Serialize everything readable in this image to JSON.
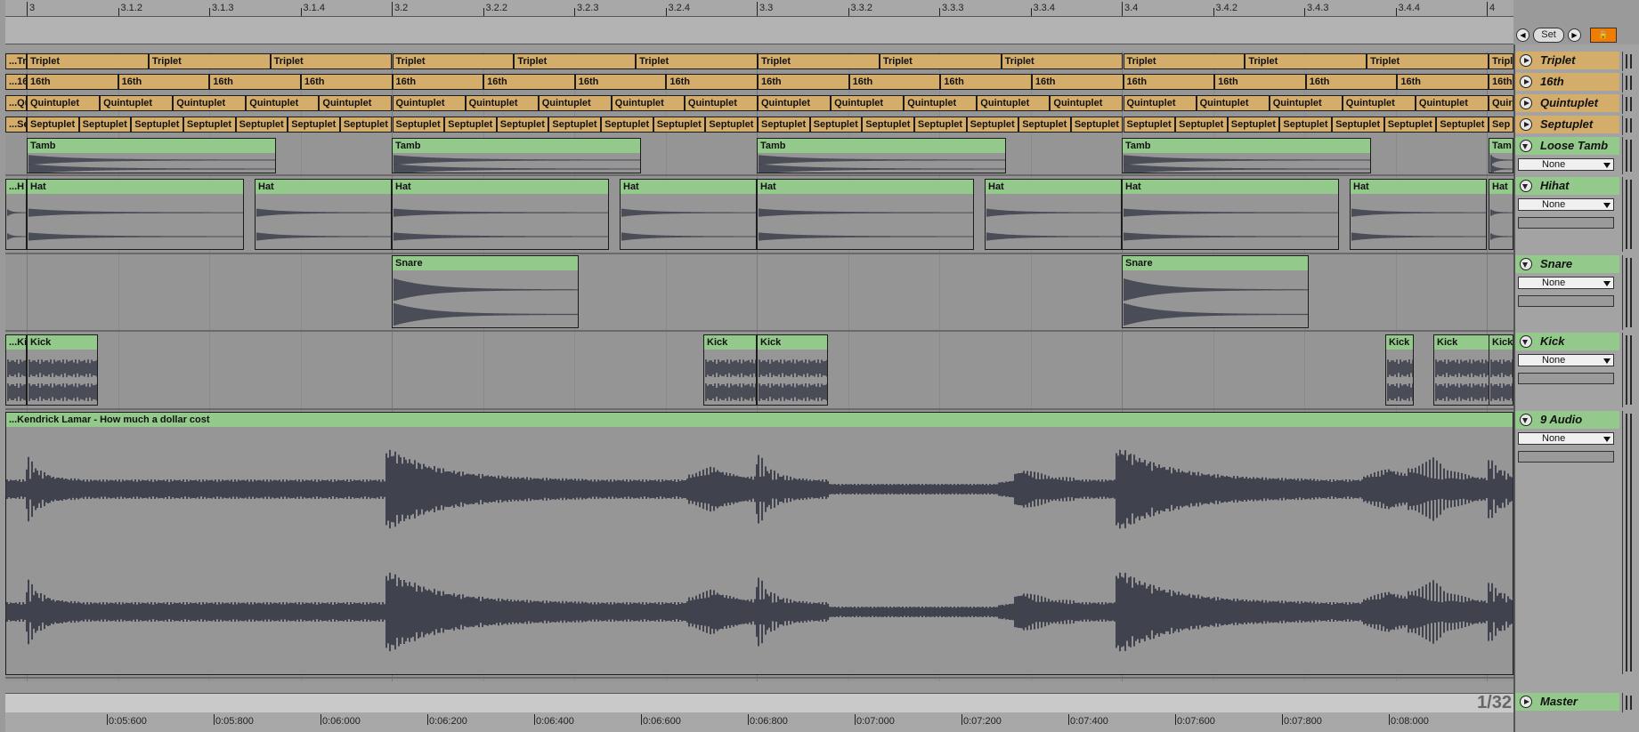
{
  "top_ruler": {
    "labels": [
      "3",
      "3.1.2",
      "3.1.3",
      "3.1.4",
      "3.2",
      "3.2.2",
      "3.2.3",
      "3.2.4",
      "3.3",
      "3.3.2",
      "3.3.3",
      "3.3.4",
      "3.4",
      "3.4.2",
      "3.4.3",
      "3.4.4",
      "4"
    ]
  },
  "bottom_ruler": {
    "labels": [
      "0:05:600",
      "0:05:800",
      "0:06:000",
      "0:06:200",
      "0:06:400",
      "0:06:600",
      "0:06:800",
      "0:07:000",
      "0:07:200",
      "0:07:400",
      "0:07:600",
      "0:07:800",
      "0:08:000"
    ]
  },
  "set_controls": {
    "prev_label": "◀",
    "set_label": "Set",
    "next_label": "▶",
    "lock_label": "🔒"
  },
  "grid_readout": "1/32",
  "clips": {
    "triplet": {
      "label": "Triplet",
      "start_label": "...Tr",
      "end_label": "Tripl"
    },
    "sixteenth": {
      "label": "16th",
      "start_label": "...16",
      "end_label": "16th"
    },
    "quintuplet": {
      "label": "Quintuplet",
      "start_label": "...Qu",
      "end_label": "Quir"
    },
    "septuplet": {
      "label": "Septuplet",
      "start_label": "...Se",
      "end_label": "Sep"
    },
    "tamb": {
      "label": "Tamb",
      "end_label": "Tam"
    },
    "hat": {
      "label": "Hat",
      "start_label": "...H"
    },
    "snare": {
      "label": "Snare"
    },
    "kick": {
      "label": "Kick",
      "start_label": "...Ki",
      "end_label": "Kick"
    },
    "audio": {
      "label": "...Kendrick Lamar - How much a dollar cost"
    }
  },
  "tracks": [
    {
      "name": "Triplet",
      "color": "#d5ad6b"
    },
    {
      "name": "16th",
      "color": "#d5ad6b"
    },
    {
      "name": "Quintuplet",
      "color": "#d5ad6b"
    },
    {
      "name": "Septuplet",
      "color": "#d5ad6b"
    },
    {
      "name": "Loose Tamb",
      "color": "#93c98a",
      "input": "None"
    },
    {
      "name": "Hihat",
      "color": "#93c98a",
      "input": "None"
    },
    {
      "name": "Snare",
      "color": "#93c98a",
      "input": "None"
    },
    {
      "name": "Kick",
      "color": "#93c98a",
      "input": "None"
    },
    {
      "name": "9 Audio",
      "color": "#93c98a",
      "input": "None"
    }
  ],
  "master": {
    "name": "Master"
  }
}
